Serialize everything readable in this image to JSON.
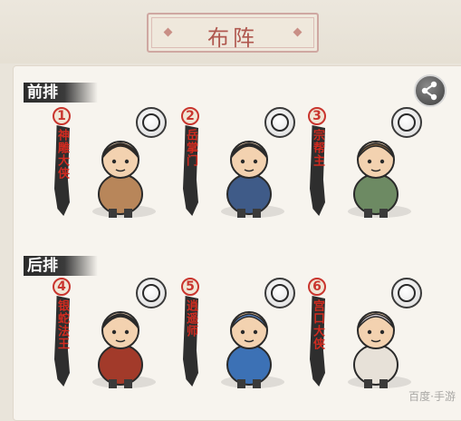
{
  "header": {
    "title": "布阵"
  },
  "rows": [
    {
      "label": "前排"
    },
    {
      "label": "后排"
    }
  ],
  "heroes": [
    {
      "index": "1",
      "name": "神雕大侠",
      "skill_icon": "yin-yang-icon",
      "outfit": "#b8865a",
      "hair": "#3b2a1e"
    },
    {
      "index": "2",
      "name": "岳掌门",
      "skill_icon": "swirl-icon",
      "outfit": "#3f5b88",
      "hair": "#2b2b2b"
    },
    {
      "index": "3",
      "name": "宗帮主",
      "skill_icon": "yin-yang-icon",
      "outfit": "#6d8a63",
      "hair": "#7a5b3a"
    },
    {
      "index": "4",
      "name": "银蛇法王",
      "skill_icon": "crossed-blades-icon",
      "outfit": "#a23a2a",
      "hair": "#2b2b2b"
    },
    {
      "index": "5",
      "name": "逍遥师",
      "skill_icon": "fan-icon",
      "outfit": "#3c71b5",
      "hair": "#5a86c7"
    },
    {
      "index": "6",
      "name": "宫口大侠",
      "skill_icon": "crossed-blades-icon",
      "outfit": "#e7e1d8",
      "hair": "#d8d0d8"
    }
  ],
  "watermark": "百度·手游"
}
